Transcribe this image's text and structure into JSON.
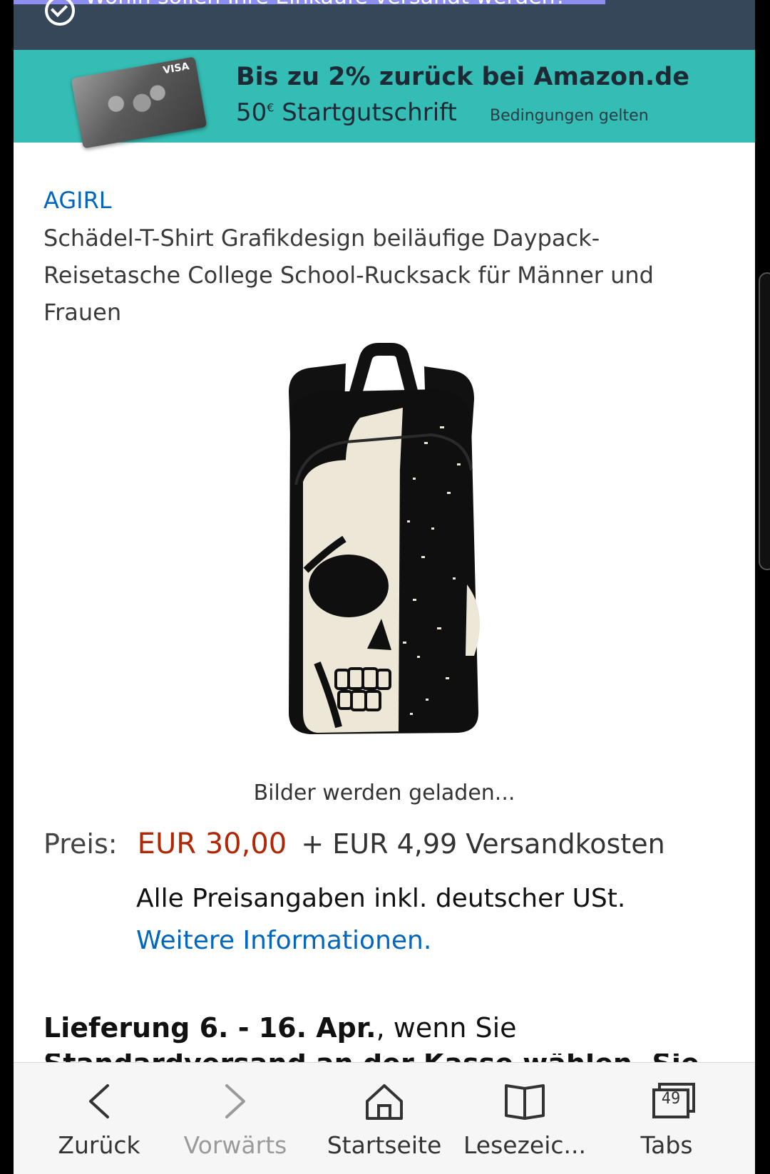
{
  "topbar": {
    "deliver_prompt": "Wohin sollen Ihre Einkäufe versandt werden?"
  },
  "promo": {
    "line1": "Bis zu 2% zurück bei Amazon.de",
    "line2_amount": "50",
    "line2_currency": "€",
    "line2_text": "Startgutschrift",
    "terms": "Bedingungen gelten",
    "card_brand": "VISA"
  },
  "product": {
    "brand": "AGIRL",
    "title": "Schädel-T-Shirt Grafikdesign beiläufige Daypack-Reisetasche College School-Rucksack für Männer und Frauen",
    "image_status": "Bilder werden geladen...",
    "price_label": "Preis:",
    "price": "EUR 30,00",
    "shipping": "+ EUR 4,99 Versandkosten",
    "tax_note": "Alle Preisangaben inkl. deutscher USt.",
    "more_info": "Weitere Informationen.",
    "delivery_bold": "Lieferung 6. - 16. Apr.",
    "delivery_rest": ", wenn Sie",
    "delivery_next": "Standardversand an der Kasse wählen. Sie"
  },
  "bottom_nav": {
    "back": "Zurück",
    "forward": "Vorwärts",
    "home": "Startseite",
    "bookmarks": "Lesezeic...",
    "tabs": "Tabs",
    "tab_count": "49"
  }
}
